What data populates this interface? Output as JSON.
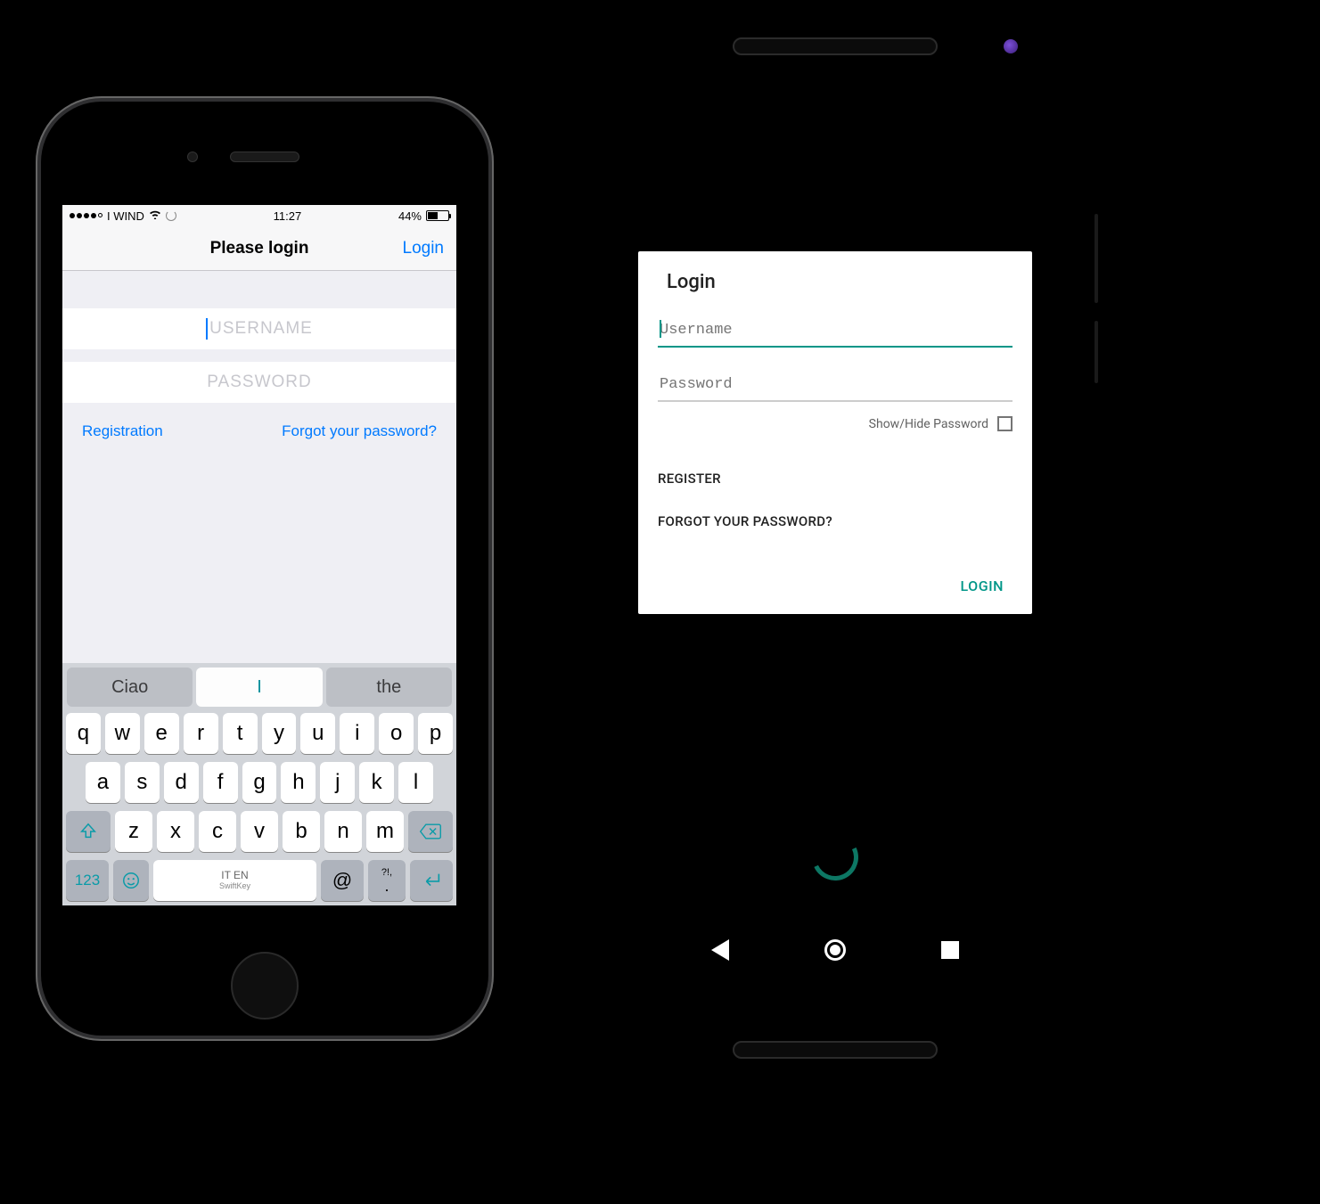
{
  "ios": {
    "status": {
      "carrier": "I WIND",
      "time": "11:27",
      "battery_pct": "44%"
    },
    "nav": {
      "title": "Please login",
      "right": "Login"
    },
    "fields": {
      "username_placeholder": "USERNAME",
      "password_placeholder": "PASSWORD"
    },
    "links": {
      "registration": "Registration",
      "forgot": "Forgot your password?"
    },
    "keyboard": {
      "suggestions": [
        "Ciao",
        "I",
        "the"
      ],
      "row1": [
        "q",
        "w",
        "e",
        "r",
        "t",
        "y",
        "u",
        "i",
        "o",
        "p"
      ],
      "row2": [
        "a",
        "s",
        "d",
        "f",
        "g",
        "h",
        "j",
        "k",
        "l"
      ],
      "row3": [
        "z",
        "x",
        "c",
        "v",
        "b",
        "n",
        "m"
      ],
      "n123": "123",
      "space_lang": "IT EN",
      "space_brand": "SwiftKey",
      "at": "@",
      "punct_top": "?!,",
      "punct_bot": "."
    }
  },
  "android": {
    "card": {
      "title": "Login",
      "username_placeholder": "Username",
      "password_placeholder": "Password",
      "show_hide": "Show/Hide Password",
      "register": "REGISTER",
      "forgot": "FORGOT YOUR PASSWORD?",
      "login": "LOGIN"
    }
  }
}
